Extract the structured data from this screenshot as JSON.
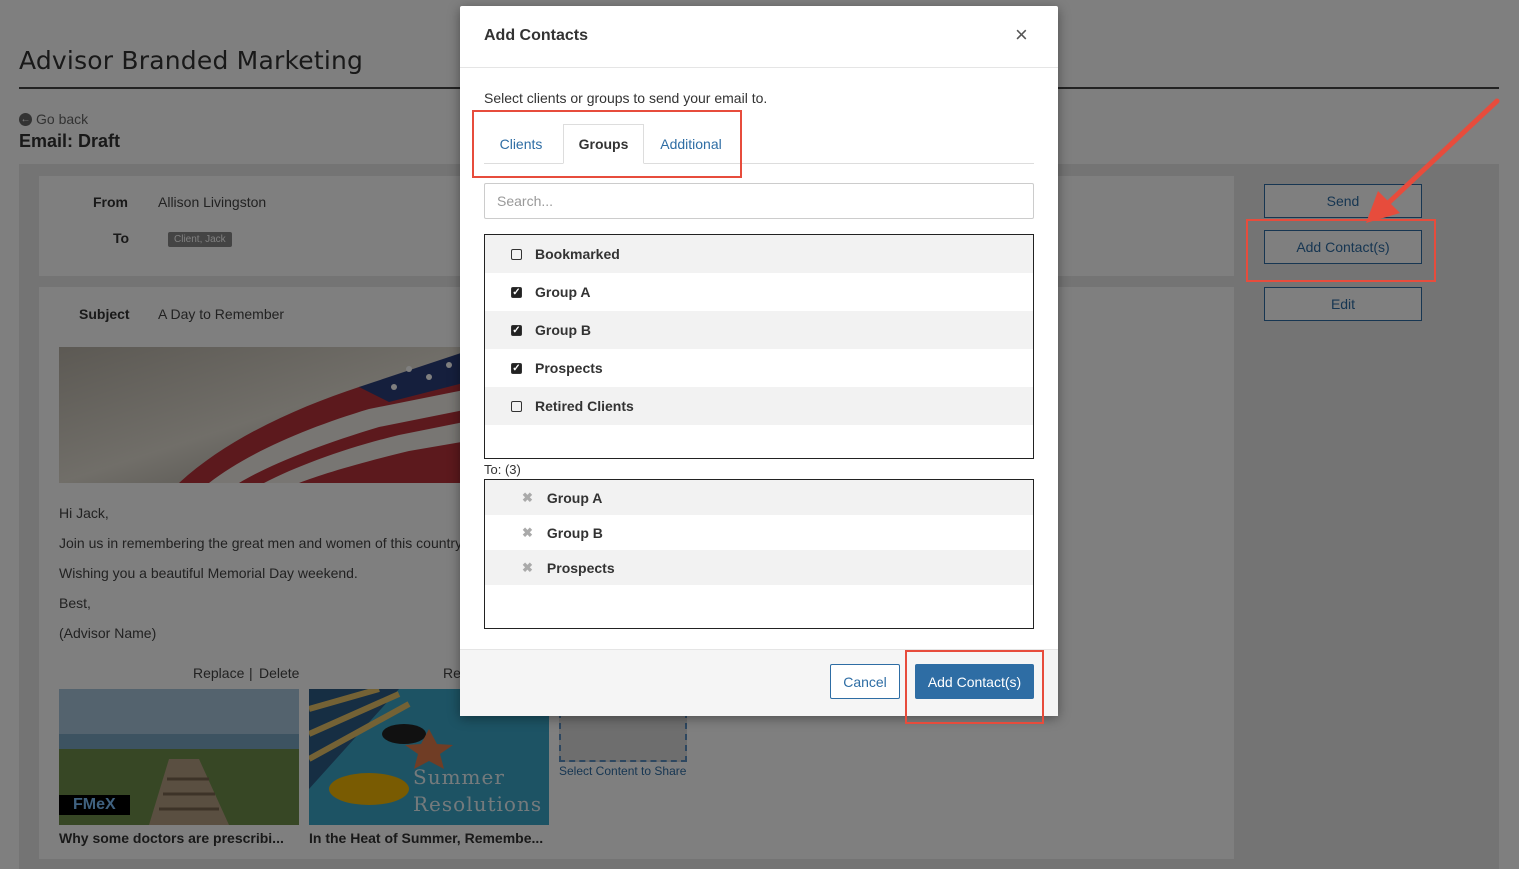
{
  "page": {
    "title": "Advisor Branded Marketing",
    "go_back": "Go back",
    "status": "Email: Draft"
  },
  "email": {
    "from_label": "From",
    "from_value": "Allison Livingston",
    "to_label": "To",
    "to_tag": "Client, Jack",
    "subject_label": "Subject",
    "subject_value": "A Day to Remember",
    "body": [
      "Hi Jack,",
      "Join us in remembering the great men and women of this country",
      "Wishing you a beautiful Memorial Day weekend.",
      "Best,",
      "(Advisor Name)"
    ],
    "content_actions": {
      "replace": "Replace",
      "sep": "|",
      "delete": "Delete",
      "re": "Re"
    },
    "content_items": [
      {
        "caption": "Why some doctors are prescribi...",
        "badge": "FMeX"
      },
      {
        "caption": "In the Heat of Summer, Remembe...",
        "overlay_line1": "Summer",
        "overlay_line2": "Resolutions"
      }
    ],
    "select_content": "Select Content to Share"
  },
  "sidebar": {
    "send": "Send",
    "add_contacts": "Add Contact(s)",
    "edit": "Edit"
  },
  "modal": {
    "title": "Add Contacts",
    "close": "×",
    "instructions": "Select clients or groups to send your email to.",
    "tabs": [
      {
        "label": "Clients",
        "active": false
      },
      {
        "label": "Groups",
        "active": true
      },
      {
        "label": "Additional",
        "active": false
      }
    ],
    "search_placeholder": "Search...",
    "groups": [
      {
        "label": "Bookmarked",
        "checked": false
      },
      {
        "label": "Group A",
        "checked": true
      },
      {
        "label": "Group B",
        "checked": true
      },
      {
        "label": "Prospects",
        "checked": true
      },
      {
        "label": "Retired Clients",
        "checked": false
      }
    ],
    "to_label": "To: (3)",
    "selected": [
      "Group A",
      "Group B",
      "Prospects"
    ],
    "cancel": "Cancel",
    "add": "Add Contact(s)"
  },
  "colors": {
    "accent": "#2e6da4",
    "callout": "#e74c3c"
  }
}
